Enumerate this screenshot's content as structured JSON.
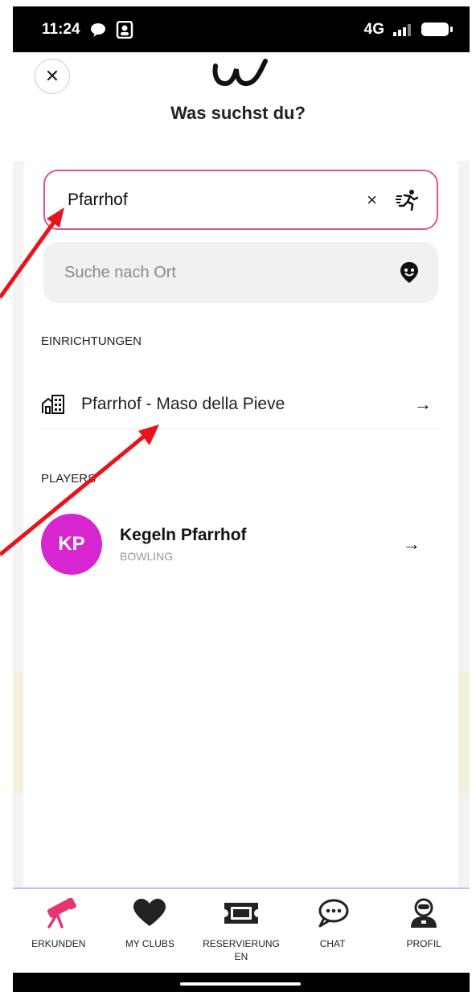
{
  "status_bar": {
    "time": "11:24",
    "network": "4G"
  },
  "header": {
    "title": "Was suchst du?"
  },
  "search": {
    "value": "Pfarrhof",
    "clear_symbol": "×",
    "icon": "running-person-icon"
  },
  "location": {
    "placeholder": "Suche nach Ort",
    "icon": "location-pin-icon"
  },
  "sections": {
    "facilities": {
      "heading": "EINRICHTUNGEN",
      "items": [
        {
          "label": "Pfarrhof - Maso della Pieve",
          "icon": "building-icon"
        }
      ]
    },
    "players": {
      "heading": "PLAYERS",
      "items": [
        {
          "initials": "KP",
          "name": "Kegeln Pfarrhof",
          "sport": "BOWLING",
          "avatar_color": "#d726d0"
        }
      ]
    }
  },
  "tabs": [
    {
      "label": "ERKUNDEN",
      "icon": "telescope-icon",
      "active": true
    },
    {
      "label": "MY CLUBS",
      "icon": "heart-icon"
    },
    {
      "label": "RESERVIERUNG EN",
      "icon": "ticket-icon"
    },
    {
      "label": "CHAT",
      "icon": "chat-bubble-icon"
    },
    {
      "label": "PROFIL",
      "icon": "profile-icon"
    }
  ],
  "colors": {
    "accent": "#e0528f",
    "annotation": "#e8141b",
    "avatar": "#d726d0"
  }
}
